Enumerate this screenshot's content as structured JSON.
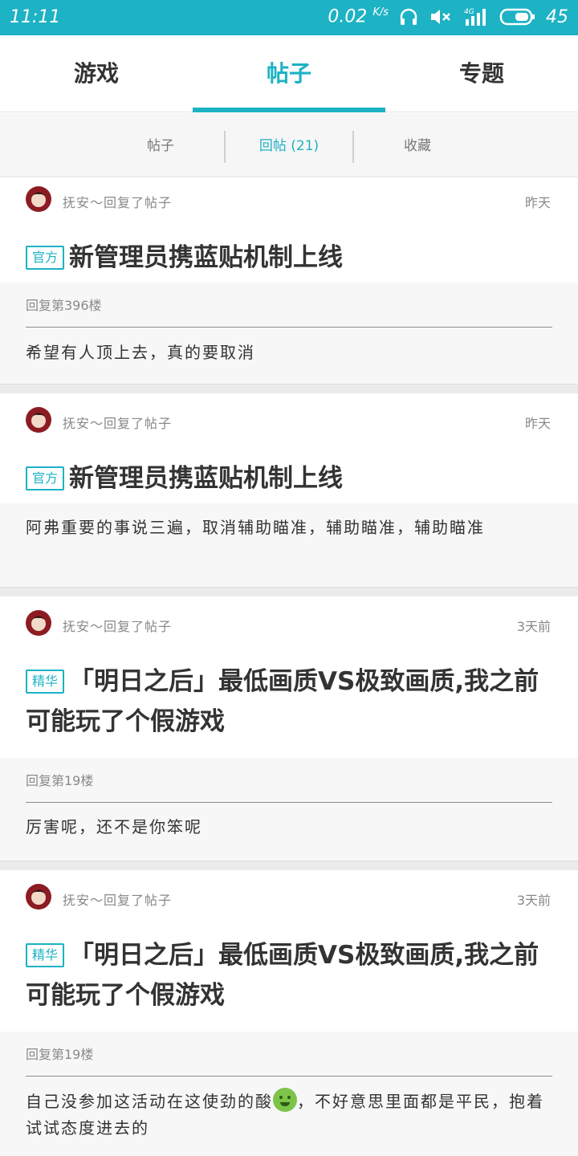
{
  "status": {
    "time": "11:11",
    "speed": "0.02",
    "speed_unit": "K/s",
    "network": "4G",
    "battery": "45"
  },
  "tabs": [
    {
      "label": "游戏",
      "active": false
    },
    {
      "label": "帖子",
      "active": true
    },
    {
      "label": "专题",
      "active": false
    }
  ],
  "subtabs": [
    {
      "label": "帖子",
      "active": false
    },
    {
      "label": "回帖 (21)",
      "active": true
    },
    {
      "label": "收藏",
      "active": false
    }
  ],
  "accent": "#1db2c4",
  "feed": [
    {
      "author": "抚安～回复了帖子",
      "time": "昨天",
      "badge": "官方",
      "title": "新管理员携蓝贴机制上线",
      "floor": "回复第396楼",
      "text": "希望有人顶上去，真的要取消"
    },
    {
      "author": "抚安～回复了帖子",
      "time": "昨天",
      "badge": "官方",
      "title": "新管理员携蓝贴机制上线",
      "floor": "",
      "text": "阿弗重要的事说三遍，取消辅助瞄准，辅助瞄准，辅助瞄准"
    },
    {
      "author": "抚安～回复了帖子",
      "time": "3天前",
      "badge": "精华",
      "title": "「明日之后」最低画质VS极致画质,我之前可能玩了个假游戏",
      "floor": "回复第19楼",
      "text": "厉害呢，还不是你笨呢"
    },
    {
      "author": "抚安～回复了帖子",
      "time": "3天前",
      "badge": "精华",
      "title": "「明日之后」最低画质VS极致画质,我之前可能玩了个假游戏",
      "floor": "回复第19楼",
      "text_a": "自己没参加这活动在这使劲的酸",
      "emoji": "nauseated-face-emoji",
      "text_b": "，不好意思里面都是平民，抱着试试态度进去的"
    }
  ]
}
